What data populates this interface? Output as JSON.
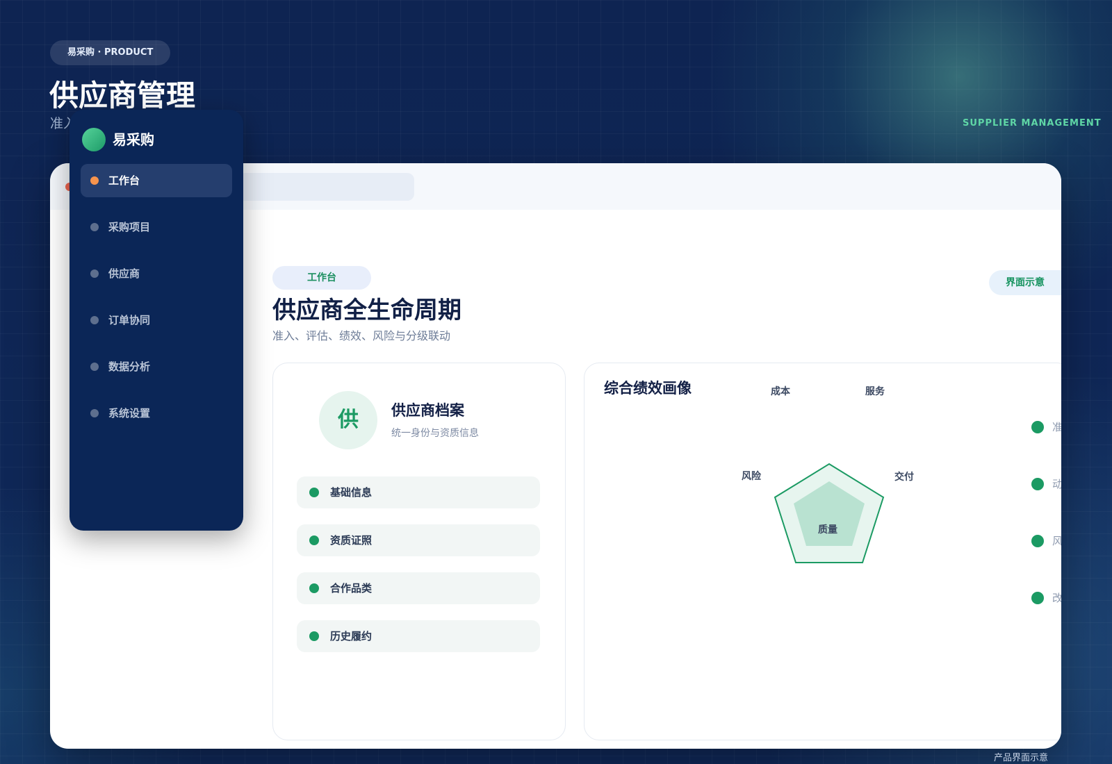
{
  "header": {
    "brand_pill": "易采购 · PRODUCT",
    "title": "供应商管理",
    "subtitle": "准入",
    "side_label": "SUPPLIER MANAGEMENT",
    "footer_note": "产品界面示意"
  },
  "sidebar": {
    "logo_text": "易采购",
    "items": [
      {
        "label": "工作台",
        "active": true
      },
      {
        "label": "采购项目",
        "active": false
      },
      {
        "label": "供应商",
        "active": false
      },
      {
        "label": "订单协同",
        "active": false
      },
      {
        "label": "数据分析",
        "active": false
      },
      {
        "label": "系统设置",
        "active": false
      }
    ]
  },
  "main": {
    "workspace_pill": "工作台",
    "demo_pill": "界面示意",
    "section_title": "供应商全生命周期",
    "section_subtitle": "准入、评估、绩效、风险与分级联动",
    "profile": {
      "avatar_char": "供",
      "title": "供应商档案",
      "subtitle": "统一身份与资质信息",
      "fields": [
        "基础信息",
        "资质证照",
        "合作品类",
        "历史履约"
      ]
    },
    "performance": {
      "title": "综合绩效画像",
      "axes": [
        "成本",
        "服务",
        "交付",
        "质量",
        "风险"
      ],
      "legend": [
        "准入评估",
        "动态绩效",
        "风险分级",
        "改进淘汰"
      ]
    }
  },
  "colors": {
    "accent": "#1b9a63",
    "active_dot": "#f7944d",
    "sidebar_bg": "#0b2657",
    "page_bg": "#0d2453"
  }
}
